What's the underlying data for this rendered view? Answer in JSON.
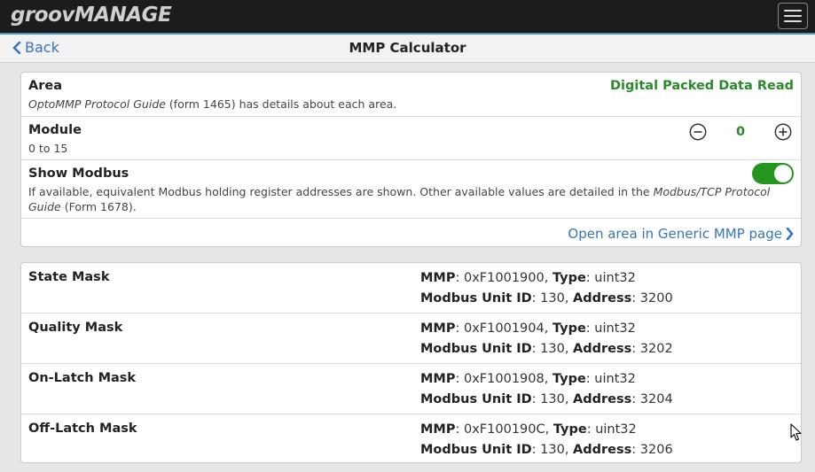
{
  "app": {
    "logo_part1": "groov",
    "logo_part2": "MANAGE"
  },
  "nav": {
    "back_label": "Back",
    "title": "MMP Calculator"
  },
  "area": {
    "label": "Area",
    "value": "Digital Packed Data Read",
    "desc_italic": "OptoMMP Protocol Guide",
    "desc_rest": " (form 1465) has details about each area."
  },
  "module": {
    "label": "Module",
    "range": "0 to 15",
    "value": "0"
  },
  "modbus": {
    "label": "Show Modbus",
    "desc_part1": "If available, equivalent Modbus holding register addresses are shown. Other available values are detailed in the ",
    "desc_italic": "Modbus/TCP Protocol Guide",
    "desc_part2": " (Form 1678).",
    "enabled": true
  },
  "link": {
    "label": "Open area in Generic MMP page"
  },
  "field_labels": {
    "mmp": "MMP",
    "type": "Type",
    "unit_id": "Modbus Unit ID",
    "address": "Address"
  },
  "results": [
    {
      "name": "State Mask",
      "mmp": "0xF1001900",
      "type": "uint32",
      "unit_id": "130",
      "address": "3200"
    },
    {
      "name": "Quality Mask",
      "mmp": "0xF1001904",
      "type": "uint32",
      "unit_id": "130",
      "address": "3202"
    },
    {
      "name": "On-Latch Mask",
      "mmp": "0xF1001908",
      "type": "uint32",
      "unit_id": "130",
      "address": "3204"
    },
    {
      "name": "Off-Latch Mask",
      "mmp": "0xF100190C",
      "type": "uint32",
      "unit_id": "130",
      "address": "3206"
    }
  ],
  "colors": {
    "accent": "#4a90c8",
    "link": "#3477b8",
    "value_green": "#2a8a2a",
    "toggle_on": "#26951f"
  }
}
